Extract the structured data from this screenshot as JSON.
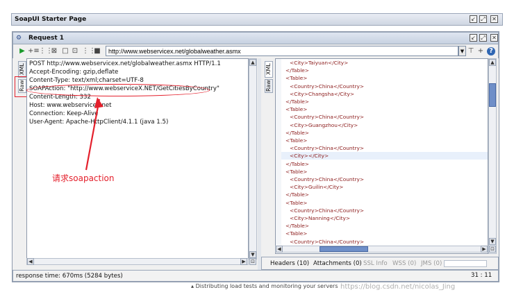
{
  "window": {
    "title": "SoapUI Starter Page"
  },
  "request": {
    "title": "Request 1",
    "endpoint": "http://www.webservicex.net/globalweather.asmx"
  },
  "request_tabs": {
    "xml": "XML",
    "raw": "Raw"
  },
  "response_tabs": {
    "xml": "XML",
    "raw": "Raw"
  },
  "request_lines": [
    "POST http://www.webservicex.net/globalweather.asmx HTTP/1.1",
    "Accept-Encoding: gzip,deflate",
    "Content-Type: text/xml;charset=UTF-8",
    "SOAPAction: \"http://www.webserviceX.NET/GetCitiesByCountry\"",
    "Content-Length: 332",
    "Host: www.webservicex.net",
    "Connection: Keep-Alive",
    "User-Agent: Apache-HttpClient/4.1.1 (java 1.5)"
  ],
  "annotation": {
    "text": "请求soapaction",
    "color": "#e4202c"
  },
  "response_lines": [
    {
      "t": "<City>Taiyuan</City>",
      "i": 2
    },
    {
      "t": "</Table>",
      "i": 1
    },
    {
      "t": "<Table>",
      "i": 1
    },
    {
      "t": "<Country>China</Country>",
      "i": 2
    },
    {
      "t": "<City>Changsha</City>",
      "i": 2
    },
    {
      "t": "</Table>",
      "i": 1
    },
    {
      "t": "<Table>",
      "i": 1
    },
    {
      "t": "<Country>China</Country>",
      "i": 2
    },
    {
      "t": "<City>Guangzhou</City>",
      "i": 2
    },
    {
      "t": "</Table>",
      "i": 1
    },
    {
      "t": "<Table>",
      "i": 1
    },
    {
      "t": "<Country>China</Country>",
      "i": 2
    },
    {
      "t": "<City></City>",
      "i": 2
    },
    {
      "t": "</Table>",
      "i": 1
    },
    {
      "t": "<Table>",
      "i": 1
    },
    {
      "t": "<Country>China</Country>",
      "i": 2
    },
    {
      "t": "<City>Guilin</City>",
      "i": 2
    },
    {
      "t": "</Table>",
      "i": 1
    },
    {
      "t": "<Table>",
      "i": 1
    },
    {
      "t": "<Country>China</Country>",
      "i": 2
    },
    {
      "t": "<City>Nanning</City>",
      "i": 2
    },
    {
      "t": "</Table>",
      "i": 1
    },
    {
      "t": "<Table>",
      "i": 1
    },
    {
      "t": "<Country>China</Country>",
      "i": 2
    }
  ],
  "bottom_tabs": {
    "headers": "Headers (10)",
    "attachments": "Attachments (0)",
    "ssl": "SSL Info",
    "wss": "WSS (0)",
    "jms": "JMS (0)"
  },
  "cursor_pos": "31 : 11",
  "status": {
    "response_time": "response time: 670ms (5284 bytes)"
  },
  "footer": {
    "hint": "Distributing load tests and monitoring your servers",
    "watermark": "https://blog.csdn.net/nicolas_Jing"
  },
  "colors": {
    "annotation": "#e4202c",
    "xml_tag": "#8b1a1a",
    "run_icon": "#1a9a2a"
  },
  "icons": [
    "run-icon",
    "add-assertion-icon",
    "create-test-icon",
    "maximize-icon",
    "split-icon",
    "settings-icon",
    "stop-icon",
    "dropdown-icon",
    "options-icon",
    "plus-icon",
    "help-icon"
  ]
}
